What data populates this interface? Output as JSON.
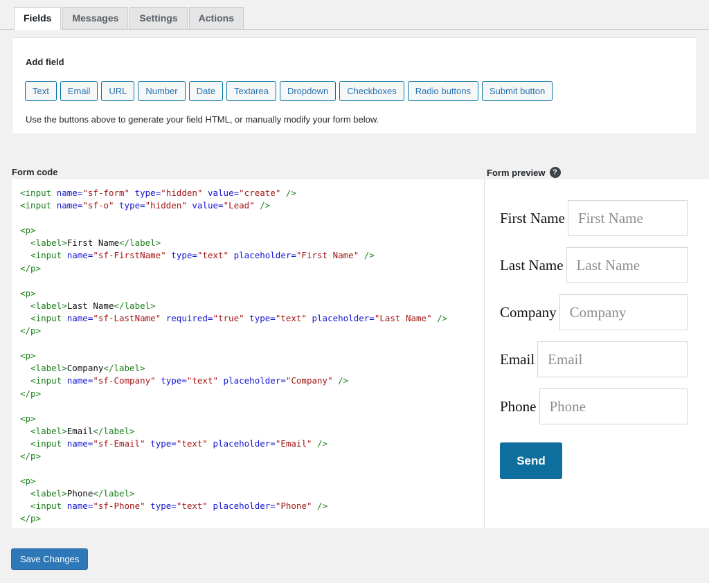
{
  "tabs": [
    {
      "label": "Fields",
      "active": true
    },
    {
      "label": "Messages",
      "active": false
    },
    {
      "label": "Settings",
      "active": false
    },
    {
      "label": "Actions",
      "active": false
    }
  ],
  "add_field": {
    "title": "Add field",
    "buttons": [
      "Text",
      "Email",
      "URL",
      "Number",
      "Date",
      "Textarea",
      "Dropdown",
      "Checkboxes",
      "Radio buttons",
      "Submit button"
    ],
    "hint": "Use the buttons above to generate your field HTML, or manually modify your form below."
  },
  "panels": {
    "code_heading": "Form code",
    "preview_heading": "Form preview",
    "help_icon": "help-icon",
    "help_glyph": "?"
  },
  "code_lines": [
    [
      {
        "t": "tag",
        "v": "<input "
      },
      {
        "t": "attr",
        "v": "name="
      },
      {
        "t": "val",
        "v": "\"sf-form\""
      },
      {
        "t": "tag",
        "v": " "
      },
      {
        "t": "attr",
        "v": "type="
      },
      {
        "t": "val",
        "v": "\"hidden\""
      },
      {
        "t": "tag",
        "v": " "
      },
      {
        "t": "attr",
        "v": "value="
      },
      {
        "t": "val",
        "v": "\"create\""
      },
      {
        "t": "tag",
        "v": " />"
      }
    ],
    [
      {
        "t": "tag",
        "v": "<input "
      },
      {
        "t": "attr",
        "v": "name="
      },
      {
        "t": "val",
        "v": "\"sf-o\""
      },
      {
        "t": "tag",
        "v": " "
      },
      {
        "t": "attr",
        "v": "type="
      },
      {
        "t": "val",
        "v": "\"hidden\""
      },
      {
        "t": "tag",
        "v": " "
      },
      {
        "t": "attr",
        "v": "value="
      },
      {
        "t": "val",
        "v": "\"Lead\""
      },
      {
        "t": "tag",
        "v": " />"
      }
    ],
    [],
    [
      {
        "t": "tag",
        "v": "<p>"
      }
    ],
    [
      {
        "t": "tag",
        "v": "  <label>"
      },
      {
        "t": "txt",
        "v": "First Name"
      },
      {
        "t": "tag",
        "v": "</label>"
      }
    ],
    [
      {
        "t": "tag",
        "v": "  <input "
      },
      {
        "t": "attr",
        "v": "name="
      },
      {
        "t": "val",
        "v": "\"sf-FirstName\""
      },
      {
        "t": "tag",
        "v": " "
      },
      {
        "t": "attr",
        "v": "type="
      },
      {
        "t": "val",
        "v": "\"text\""
      },
      {
        "t": "tag",
        "v": " "
      },
      {
        "t": "attr",
        "v": "placeholder="
      },
      {
        "t": "val",
        "v": "\"First Name\""
      },
      {
        "t": "tag",
        "v": " />"
      }
    ],
    [
      {
        "t": "tag",
        "v": "</p>"
      }
    ],
    [],
    [
      {
        "t": "tag",
        "v": "<p>"
      }
    ],
    [
      {
        "t": "tag",
        "v": "  <label>"
      },
      {
        "t": "txt",
        "v": "Last Name"
      },
      {
        "t": "tag",
        "v": "</label>"
      }
    ],
    [
      {
        "t": "tag",
        "v": "  <input "
      },
      {
        "t": "attr",
        "v": "name="
      },
      {
        "t": "val",
        "v": "\"sf-LastName\""
      },
      {
        "t": "tag",
        "v": " "
      },
      {
        "t": "attr",
        "v": "required="
      },
      {
        "t": "val",
        "v": "\"true\""
      },
      {
        "t": "tag",
        "v": " "
      },
      {
        "t": "attr",
        "v": "type="
      },
      {
        "t": "val",
        "v": "\"text\""
      },
      {
        "t": "tag",
        "v": " "
      },
      {
        "t": "attr",
        "v": "placeholder="
      },
      {
        "t": "val",
        "v": "\"Last Name\""
      },
      {
        "t": "tag",
        "v": " />"
      }
    ],
    [
      {
        "t": "tag",
        "v": "</p>"
      }
    ],
    [],
    [
      {
        "t": "tag",
        "v": "<p>"
      }
    ],
    [
      {
        "t": "tag",
        "v": "  <label>"
      },
      {
        "t": "txt",
        "v": "Company"
      },
      {
        "t": "tag",
        "v": "</label>"
      }
    ],
    [
      {
        "t": "tag",
        "v": "  <input "
      },
      {
        "t": "attr",
        "v": "name="
      },
      {
        "t": "val",
        "v": "\"sf-Company\""
      },
      {
        "t": "tag",
        "v": " "
      },
      {
        "t": "attr",
        "v": "type="
      },
      {
        "t": "val",
        "v": "\"text\""
      },
      {
        "t": "tag",
        "v": " "
      },
      {
        "t": "attr",
        "v": "placeholder="
      },
      {
        "t": "val",
        "v": "\"Company\""
      },
      {
        "t": "tag",
        "v": " />"
      }
    ],
    [
      {
        "t": "tag",
        "v": "</p>"
      }
    ],
    [],
    [
      {
        "t": "tag",
        "v": "<p>"
      }
    ],
    [
      {
        "t": "tag",
        "v": "  <label>"
      },
      {
        "t": "txt",
        "v": "Email"
      },
      {
        "t": "tag",
        "v": "</label>"
      }
    ],
    [
      {
        "t": "tag",
        "v": "  <input "
      },
      {
        "t": "attr",
        "v": "name="
      },
      {
        "t": "val",
        "v": "\"sf-Email\""
      },
      {
        "t": "tag",
        "v": " "
      },
      {
        "t": "attr",
        "v": "type="
      },
      {
        "t": "val",
        "v": "\"text\""
      },
      {
        "t": "tag",
        "v": " "
      },
      {
        "t": "attr",
        "v": "placeholder="
      },
      {
        "t": "val",
        "v": "\"Email\""
      },
      {
        "t": "tag",
        "v": " />"
      }
    ],
    [
      {
        "t": "tag",
        "v": "</p>"
      }
    ],
    [],
    [
      {
        "t": "tag",
        "v": "<p>"
      }
    ],
    [
      {
        "t": "tag",
        "v": "  <label>"
      },
      {
        "t": "txt",
        "v": "Phone"
      },
      {
        "t": "tag",
        "v": "</label>"
      }
    ],
    [
      {
        "t": "tag",
        "v": "  <input "
      },
      {
        "t": "attr",
        "v": "name="
      },
      {
        "t": "val",
        "v": "\"sf-Phone\""
      },
      {
        "t": "tag",
        "v": " "
      },
      {
        "t": "attr",
        "v": "type="
      },
      {
        "t": "val",
        "v": "\"text\""
      },
      {
        "t": "tag",
        "v": " "
      },
      {
        "t": "attr",
        "v": "placeholder="
      },
      {
        "t": "val",
        "v": "\"Phone\""
      },
      {
        "t": "tag",
        "v": " />"
      }
    ],
    [
      {
        "t": "tag",
        "v": "</p>"
      }
    ]
  ],
  "preview": {
    "fields": [
      {
        "label": "First Name",
        "placeholder": "First Name"
      },
      {
        "label": "Last Name",
        "placeholder": "Last Name"
      },
      {
        "label": "Company",
        "placeholder": "Company"
      },
      {
        "label": "Email",
        "placeholder": "Email"
      },
      {
        "label": "Phone",
        "placeholder": "Phone"
      }
    ],
    "submit_label": "Send"
  },
  "footer": {
    "save_label": "Save Changes"
  },
  "colors": {
    "page_bg": "#f1f1f1",
    "panel_bg": "#ffffff",
    "link_blue": "#2271b1",
    "send_blue": "#0e6e9e",
    "save_blue": "#2e78b7",
    "code_tag": "#1a7f1a",
    "code_attr": "#1414cf",
    "code_value": "#a31515"
  }
}
